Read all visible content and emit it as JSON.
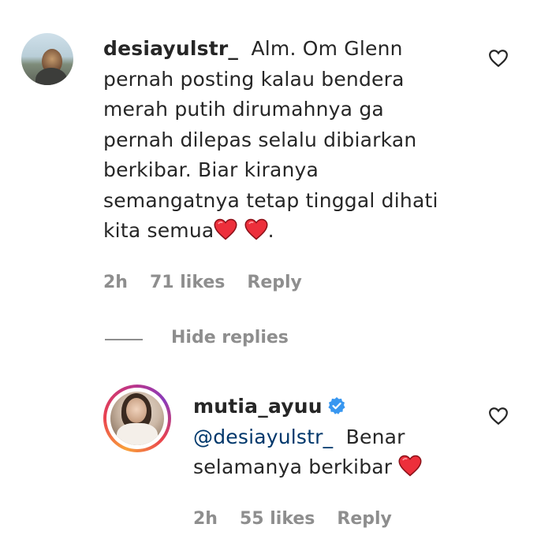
{
  "comment": {
    "username": "desiayulstr_",
    "lines": [
      "Alm. Om Glenn",
      "pernah posting kalau bendera",
      "merah putih dirumahnya ga",
      "pernah dilepas selalu dibiarkan",
      "berkibar. Biar kiranya",
      "semangatnya tetap tinggal dihati",
      "kita semua"
    ],
    "line_end": ".",
    "time": "2h",
    "likes": "71 likes",
    "reply": "Reply"
  },
  "hide_replies": "Hide replies",
  "reply_comment": {
    "username": "mutia_ayuu",
    "mention": "@desiayulstr_",
    "text_after_mention": "Benar",
    "line2": "selamanya berkibar",
    "time": "2h",
    "likes": "55 likes",
    "reply": "Reply"
  },
  "colors": {
    "text": "#262626",
    "meta": "#8e8e8e",
    "mention": "#00376b",
    "heart_red": "#ed4956",
    "verified_blue": "#3897f0"
  }
}
